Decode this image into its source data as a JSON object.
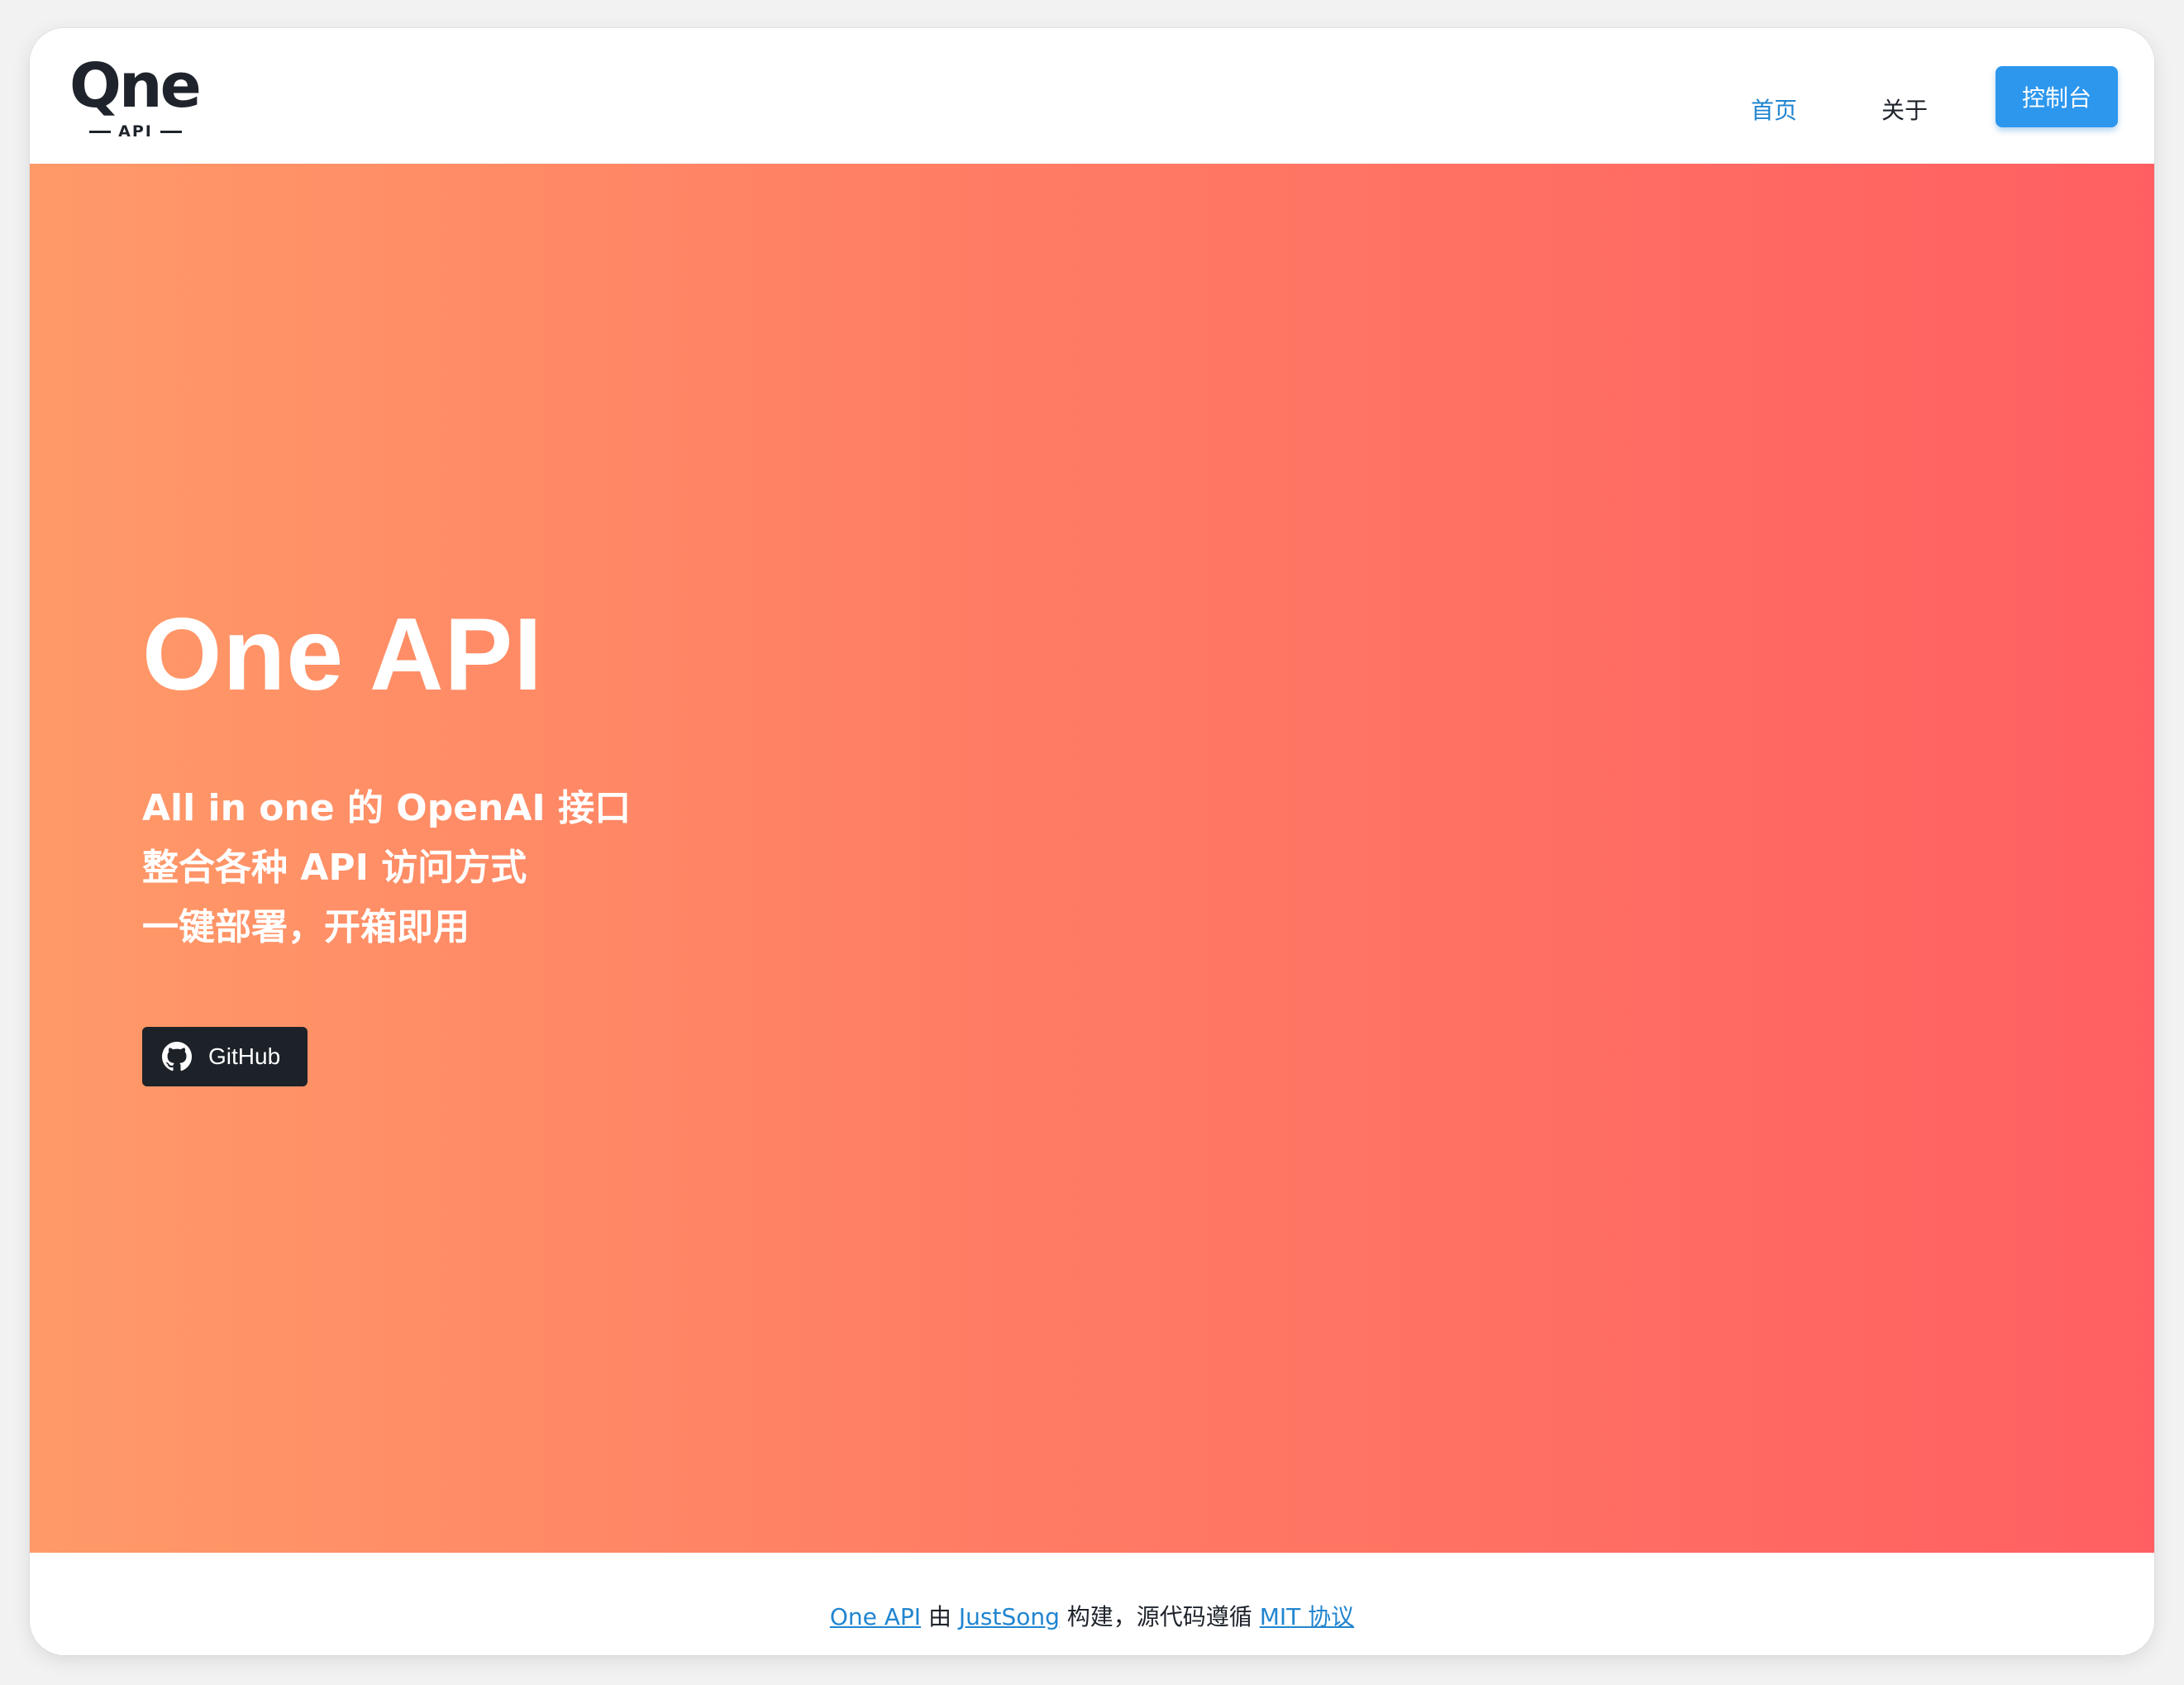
{
  "header": {
    "logo_word": "Qne",
    "logo_sub": "API",
    "nav_home": "首页",
    "nav_about": "关于",
    "console_button": "控制台"
  },
  "hero": {
    "title": "One API",
    "lines": [
      "All in one 的 OpenAI 接口",
      "整合各种 API 访问方式",
      "一键部署，开箱即用"
    ],
    "github_label": "GitHub",
    "gradient_colors": [
      "#ff9a68",
      "#ff5f62"
    ]
  },
  "footer": {
    "project_link": "One API",
    "by": "由",
    "author_link": "JustSong",
    "middle": "构建，源代码遵循",
    "license_link": "MIT 协议"
  },
  "colors": {
    "accent": "#2185d0",
    "button_primary": "#2d97ee",
    "github_button": "#1d2229",
    "text_dark": "#1f242c"
  },
  "icons": {
    "github": "github-icon"
  }
}
